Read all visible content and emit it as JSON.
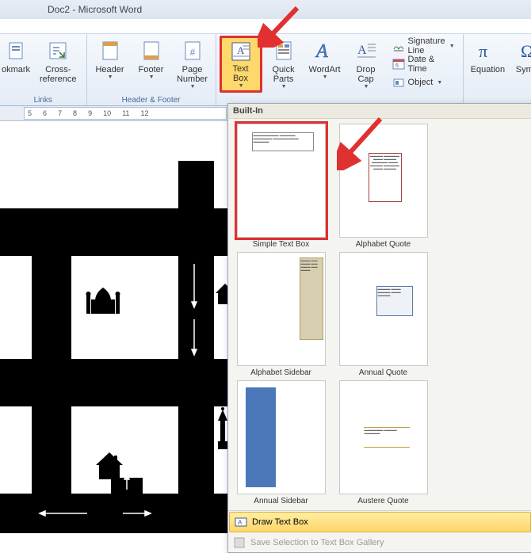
{
  "window": {
    "title": "Doc2 - Microsoft Word"
  },
  "ribbon": {
    "links_group": "Links",
    "hf_group": "Header & Footer",
    "bookmark": "okmark",
    "crossref": "Cross-reference",
    "header": "Header",
    "footer": "Footer",
    "pagenum": "Page\nNumber",
    "textbox": "Text\nBox",
    "quickparts": "Quick\nParts",
    "wordart": "WordArt",
    "dropcap": "Drop\nCap",
    "sigline": "Signature Line",
    "datetime": "Date & Time",
    "object": "Object",
    "equation": "Equation",
    "symbol": "Symbol"
  },
  "ruler": {
    "n5": "5",
    "n6": "6",
    "n7": "7",
    "n8": "8",
    "n9": "9",
    "n10": "10",
    "n11": "11",
    "n12": "12"
  },
  "gallery": {
    "header": "Built-In",
    "simple": "Simple Text Box",
    "alpha_q": "Alphabet Quote",
    "alpha_s": "Alphabet Sidebar",
    "ann_q": "Annual Quote",
    "ann_s": "Annual Sidebar",
    "aus_q": "Austere Quote",
    "draw": "Draw Text Box",
    "save": "Save Selection to Text Box Gallery"
  }
}
